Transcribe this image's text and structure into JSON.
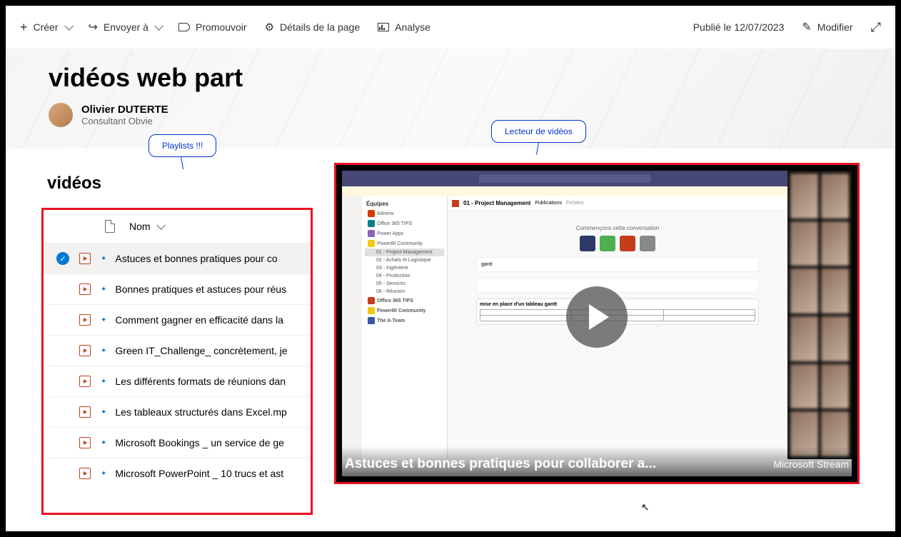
{
  "toolbar": {
    "create": "Créer",
    "send_to": "Envoyer à",
    "promote": "Promouvoir",
    "page_details": "Détails de la page",
    "analytics": "Analyse",
    "published": "Publié le 12/07/2023",
    "modify": "Modifier"
  },
  "page_title": "vidéos web part",
  "author": {
    "name": "Olivier DUTERTE",
    "role": "Consultant Obvie"
  },
  "callouts": {
    "playlist": "Playlists !!!",
    "player": "Lecteur de vidéos"
  },
  "section_title": "vidéos",
  "columns": {
    "name": "Nom"
  },
  "items": [
    "Astuces et bonnes pratiques pour co",
    "Bonnes pratiques et astuces pour réus",
    "Comment gagner en efficacité dans la",
    "Green IT_Challenge_ concrètement, je",
    "Les différents formats de réunions dan",
    "Les tableaux structurés dans Excel.mp",
    "Microsoft Bookings _ un service de ge",
    "Microsoft PowerPoint _ 10 trucs et ast"
  ],
  "player": {
    "title": "Astuces et bonnes pratiques pour collaborer a...",
    "brand": "Microsoft Stream"
  },
  "teams": {
    "equipes": "Équipes",
    "channel": "01 - Project Management",
    "tab_pub": "Publications",
    "tab_file": "Fichiers",
    "start_conv": "Commençons cette conversation",
    "compose_title": "mise en place d'un tableau gantt",
    "msg_tag": "gantt",
    "sidebar_items": [
      "Admins",
      "Office 365 TIPS",
      "Power Apps",
      "PowerBI Community"
    ],
    "channels": [
      "01 - Project Management",
      "02 - Achats et Logistique",
      "03 - Ingénierie",
      "04 - Production",
      "05 - Services",
      "06 - Réunion"
    ],
    "office_tips": "Office 365 TIPS",
    "powerbi": "PowerBI Community",
    "ateam": "The A-Team"
  }
}
